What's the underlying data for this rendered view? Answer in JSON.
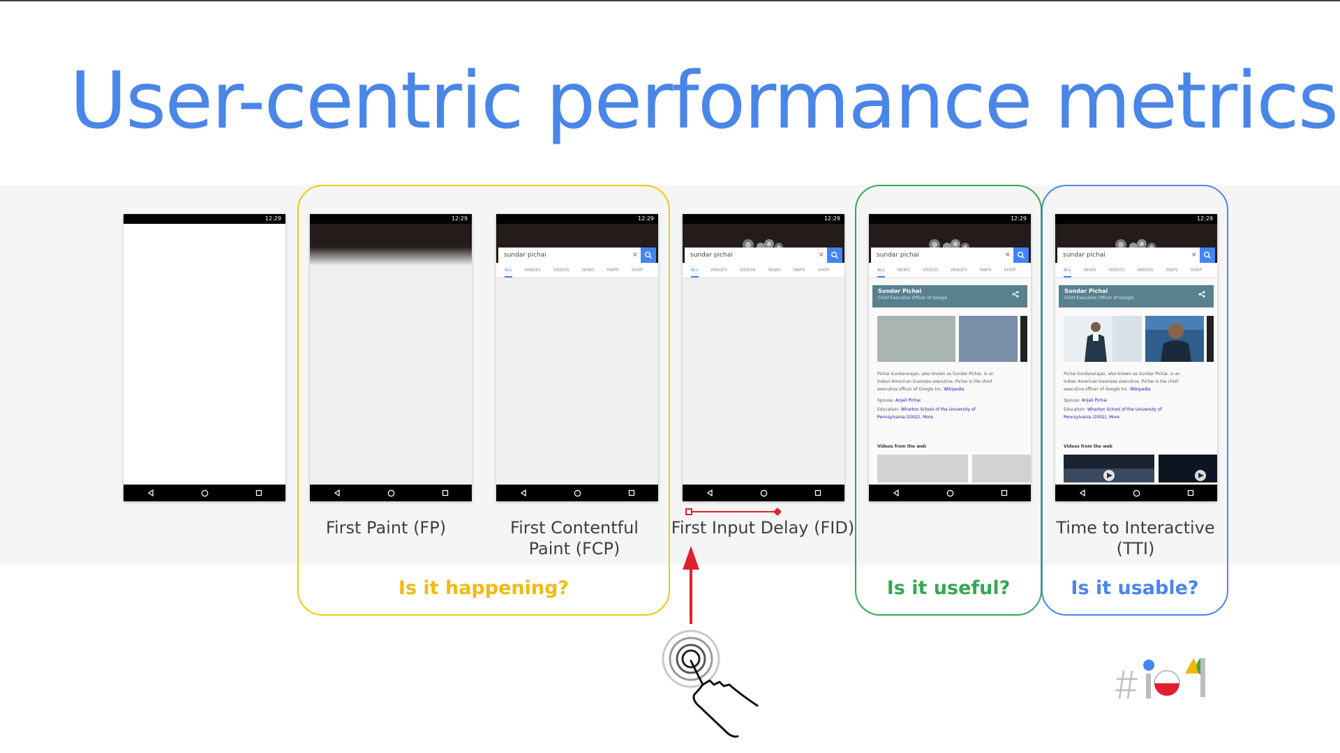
{
  "slide": {
    "title": "User-centric performance metrics"
  },
  "phones": {
    "status_time": "12:29",
    "search_query": "sundar pichai",
    "search_clear": "×",
    "tabs_a": [
      "ALL",
      "IMAGES",
      "VIDEOS",
      "NEWS",
      "MAPS",
      "SHOP"
    ],
    "tabs_b": [
      "ALL",
      "NEWS",
      "VIDEOS",
      "IMAGES",
      "MAPS",
      "SHOP"
    ],
    "kp_name": "Sundar Pichai",
    "kp_subtitle": "Chief Executive Officer of Google",
    "bio_text_1": "Pichai Sundararajan, also known as Sundar Pichai, is an",
    "bio_text_2": "Indian American business executive. Pichai is the chief",
    "bio_text_3": "executive officer of Google Inc.",
    "bio_link": "Wikipedia",
    "spouse_label": "Spouse:",
    "spouse_value": "Anjali Pichai",
    "education_label": "Education:",
    "education_value": "Wharton School of the University of",
    "education_value_2": "Pennsylvania (2002),",
    "education_more": "More",
    "videos_label": "Videos from the web"
  },
  "captions": {
    "fp": "First Paint (FP)",
    "fcp_line1": "First Contentful",
    "fcp_line2": "Paint (FCP)",
    "fid": "First Input Delay (FID)",
    "tti_line1": "Time to Interactive",
    "tti_line2": "(TTI)"
  },
  "questions": {
    "happening": "Is it happening?",
    "useful": "Is it useful?",
    "usable": "Is it usable?"
  },
  "colors": {
    "title_blue": "#4a86e8",
    "yellow": "#f2c80f",
    "green": "#34a853",
    "blue": "#4a86e8",
    "red": "#e0202e"
  },
  "icons": [
    "touch-gesture-icon",
    "google-io-logo",
    "back-icon",
    "home-icon",
    "recents-icon",
    "search-icon",
    "share-icon"
  ]
}
